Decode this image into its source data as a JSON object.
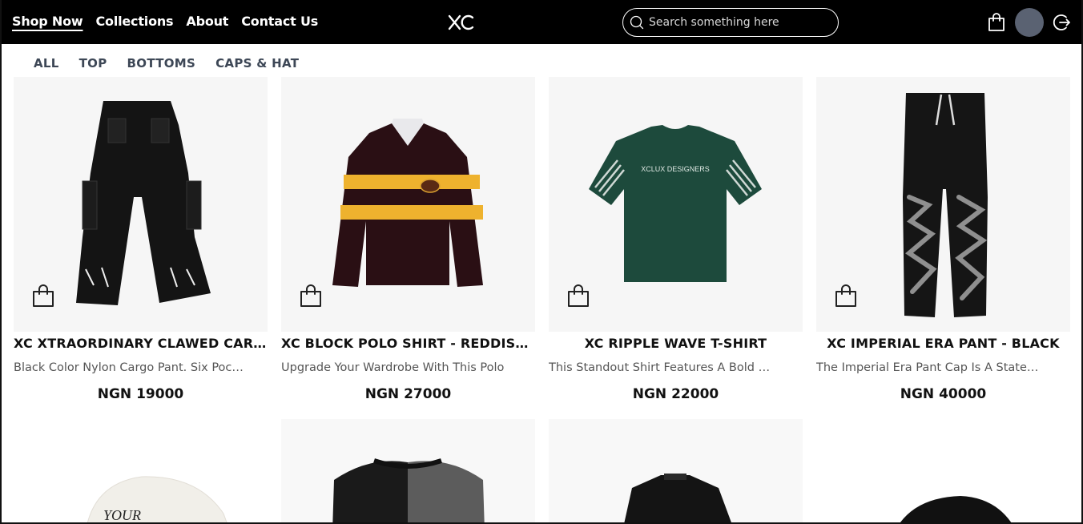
{
  "header": {
    "nav": [
      "Shop Now",
      "Collections",
      "About",
      "Contact Us"
    ],
    "logo_text": "XC",
    "search_placeholder": "Search something here"
  },
  "categories": [
    "ALL",
    "TOP",
    "BOTTOMS",
    "CAPS & HAT"
  ],
  "products": [
    {
      "name": "XC XTRAORDINARY CLAWED CARGO PANT",
      "description": "Black Color Nylon Cargo Pant. Six Pockets",
      "price": "NGN 19000"
    },
    {
      "name": "XC BLOCK POLO SHIRT - REDDISH BROWN",
      "description": "Upgrade Your Wardrobe With This Polo",
      "price": "NGN 27000"
    },
    {
      "name": "XC RIPPLE WAVE T-SHIRT",
      "description": "This Standout Shirt Features A Bold Design",
      "price": "NGN 22000"
    },
    {
      "name": "XC IMPERIAL ERA PANT - BLACK",
      "description": "The Imperial Era Pant Cap Is A Statement",
      "price": "NGN 40000"
    }
  ],
  "graphics": {
    "tshirt_print": "XCLUX DESIGNERS",
    "cap_print": "YOUR"
  },
  "colors": {
    "header_bg": "#000000",
    "avatar": "#5a6272",
    "polo_main": "#2a0f14",
    "polo_stripe": "#eeb22e",
    "tshirt": "#1d4a3c"
  }
}
